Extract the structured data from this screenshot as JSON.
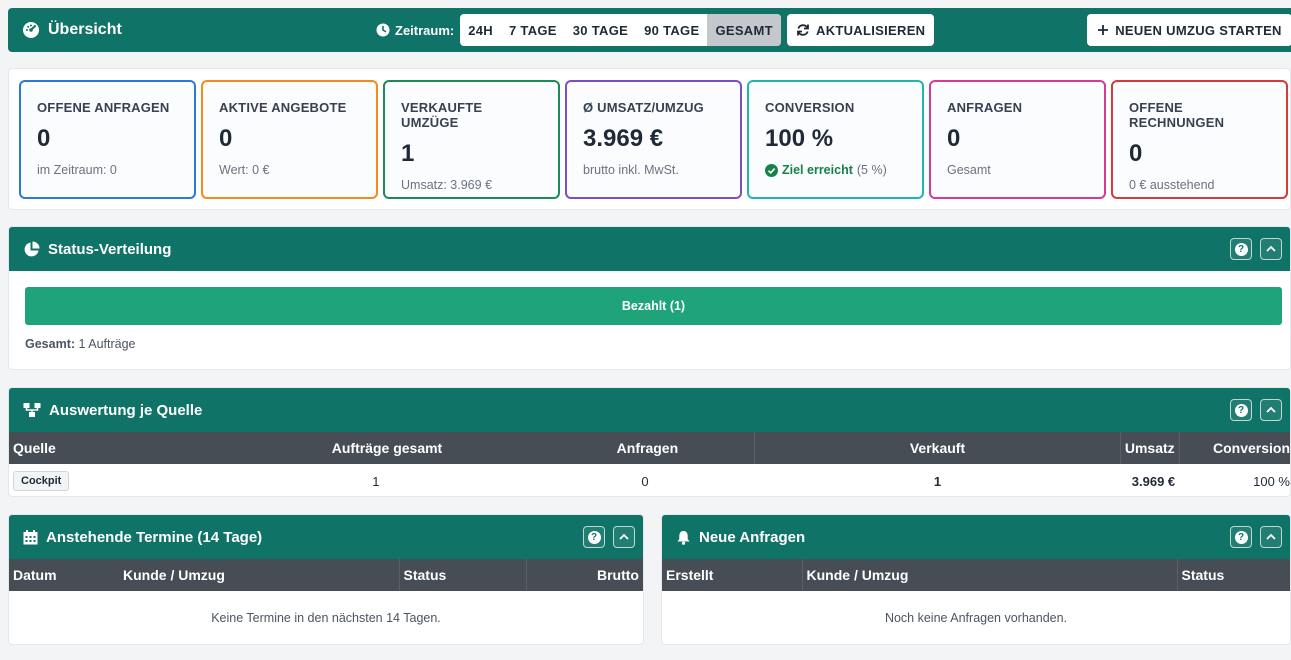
{
  "header": {
    "title": "Übersicht",
    "period_label": "Zeitraum:",
    "periods": [
      "24H",
      "7 TAGE",
      "30 TAGE",
      "90 TAGE",
      "GESAMT"
    ],
    "active_period": "GESAMT",
    "refresh_label": "AKTUALISIEREN",
    "new_move_label": "NEUEN UMZUG STARTEN"
  },
  "kpis": [
    {
      "label": "OFFENE ANFRAGEN",
      "value": "0",
      "sub": "im Zeitraum: 0",
      "color": "#2b7bd4"
    },
    {
      "label": "AKTIVE ANGEBOTE",
      "value": "0",
      "sub": "Wert: 0 €",
      "color": "#f28c1e"
    },
    {
      "label": "VERKAUFTE UMZÜGE",
      "value": "1",
      "sub": "Umsatz: 3.969 €",
      "color": "#1d8a5a"
    },
    {
      "label": "Ø UMSATZ/UMZUG",
      "value": "3.969 €",
      "sub": "brutto inkl. MwSt.",
      "color": "#7b4fc4"
    },
    {
      "label": "CONVERSION",
      "value": "100 %",
      "sub_ok": "Ziel erreicht",
      "sub": "(5 %)",
      "color": "#1fb5b0"
    },
    {
      "label": "ANFRAGEN",
      "value": "0",
      "sub": "Gesamt",
      "color": "#d63a97"
    },
    {
      "label": "OFFENE RECHNUNGEN",
      "value": "0",
      "sub": "0 € ausstehend",
      "color": "#d63a3a"
    }
  ],
  "status": {
    "title": "Status-Verteilung",
    "bar_label": "Bezahlt (1)",
    "bar_fraction": 1.0,
    "total_label": "Gesamt:",
    "total_value": "1 Aufträge"
  },
  "sources": {
    "title": "Auswertung je Quelle",
    "columns": [
      "Quelle",
      "Aufträge gesamt",
      "Anfragen",
      "Verkauft",
      "Umsatz",
      "Conversion"
    ],
    "rows": [
      {
        "quelle": "Cockpit",
        "auftraege": "1",
        "anfragen": "0",
        "verkauft": "1",
        "umsatz": "3.969 €",
        "conversion": "100 %"
      }
    ]
  },
  "termine": {
    "title": "Anstehende Termine (14 Tage)",
    "columns": [
      "Datum",
      "Kunde / Umzug",
      "Status",
      "Brutto"
    ],
    "empty": "Keine Termine in den nächsten 14 Tagen."
  },
  "anfragen": {
    "title": "Neue Anfragen",
    "columns": [
      "Erstellt",
      "Kunde / Umzug",
      "Status"
    ],
    "empty": "Noch keine Anfragen vorhanden."
  }
}
